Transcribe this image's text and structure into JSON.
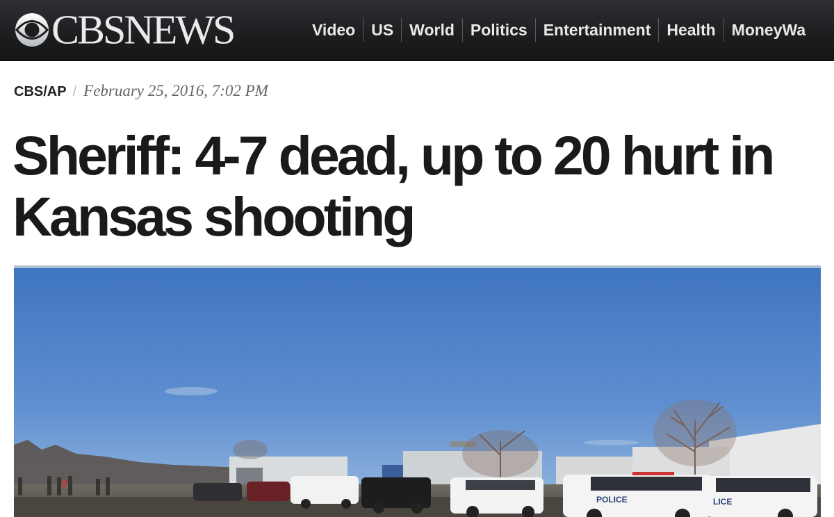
{
  "brand": {
    "name": "CBSNEWS",
    "logo_icon": "cbs-eye-icon"
  },
  "nav": {
    "items": [
      "Video",
      "US",
      "World",
      "Politics",
      "Entertainment",
      "Health",
      "MoneyWa"
    ]
  },
  "article": {
    "source": "CBS/AP",
    "separator": "/",
    "date": "February 25, 2016, 7:02 PM",
    "headline": "Sheriff: 4-7 dead, up to 20 hurt in Kansas shooting",
    "photo": {
      "vehicle_label_1": "POLICE",
      "vehicle_label_2": "LICE"
    }
  },
  "colors": {
    "topbar": "#1f2022",
    "nav_text": "#e8e8e8",
    "headline": "#1a1a1a",
    "sky": "#4c7fc4"
  }
}
